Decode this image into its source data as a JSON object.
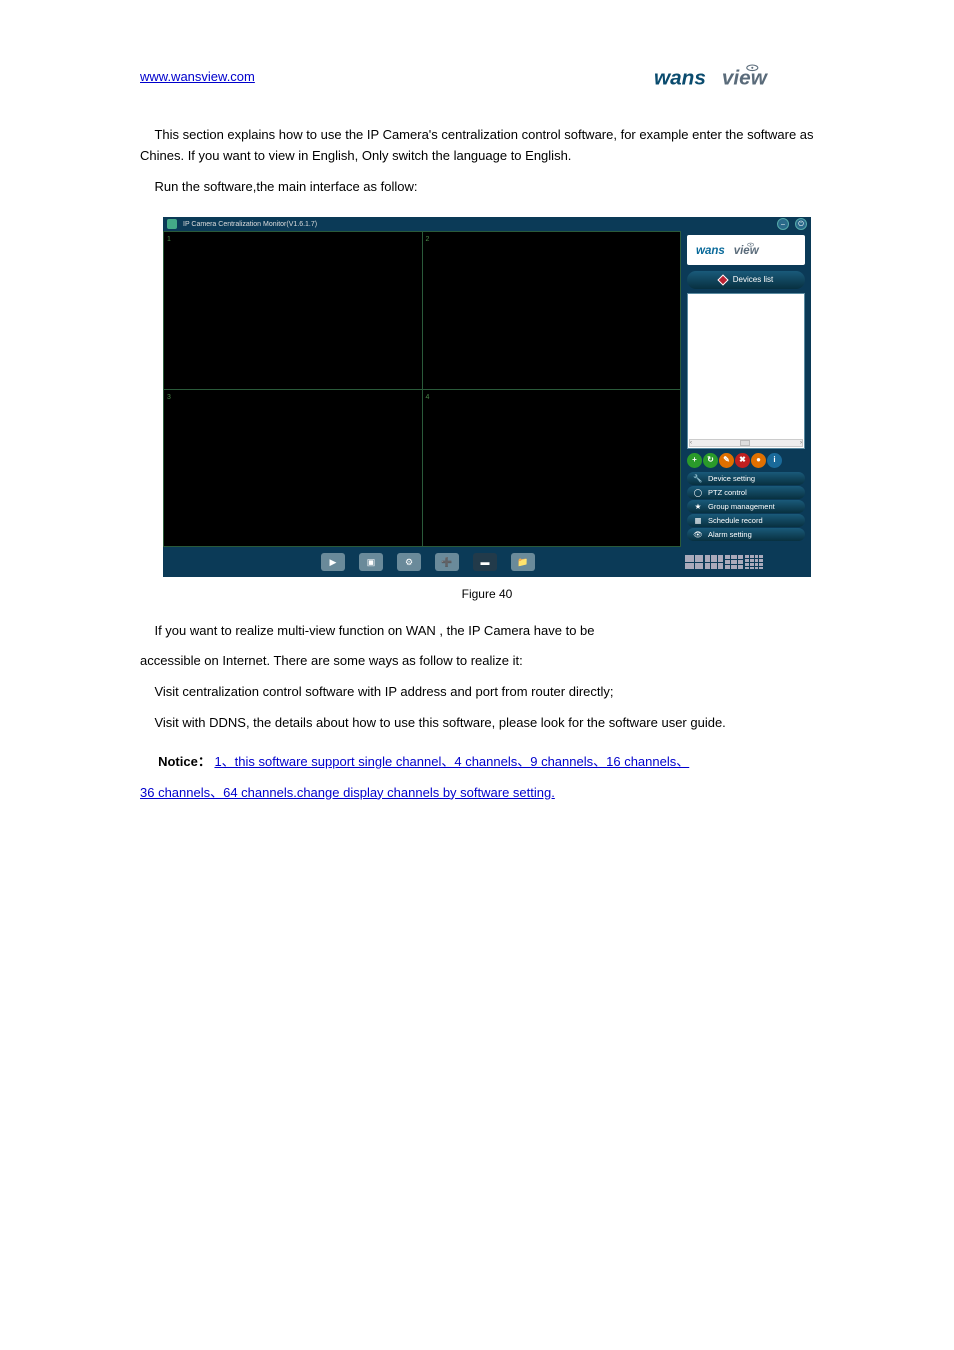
{
  "header": {
    "website_link": "www.wansview.com",
    "brand_logo_alt": "wansview"
  },
  "paragraphs": {
    "p1_intro": "This section explains how to use the IP Camera's centralization control software, for",
    "p1_cont": "example enter the software as Chines. If you want to view in English, Only switch the language to ",
    "p1_cont2": "English.",
    "run_software": "Run the software,the main interface as follow: "
  },
  "figure_caption": "Figure 40",
  "outro": {
    "line1": "If you want to realize  multi-view  function   on WAN , the IP Camera have to be ",
    "line2": "accessible on Internet. There are some ways as follow to realize it: ",
    "line3": "Visit centralization control software with IP address and port from router directly;",
    "line4": "Visit with DDNS, the details about how to use this software, please look for the software user guide."
  },
  "note": {
    "label": "Notice",
    "sep": "：",
    "text": "1、this software support single channel、4 channels、9 channels、16 channels、",
    "line2": "36 channels、64 channels.change display channels by software setting."
  },
  "screenshot": {
    "title": "IP Camera Centralization Monitor(V1.6.1.7)",
    "cells": [
      "1",
      "2",
      "3",
      "4"
    ],
    "panel": {
      "logo": "wansview",
      "devices_list_label": "Devices list",
      "scroll_text": "III",
      "func": [
        "Device setting",
        "PTZ control",
        "Group management",
        "Schedule record",
        "Alarm setting"
      ]
    }
  }
}
